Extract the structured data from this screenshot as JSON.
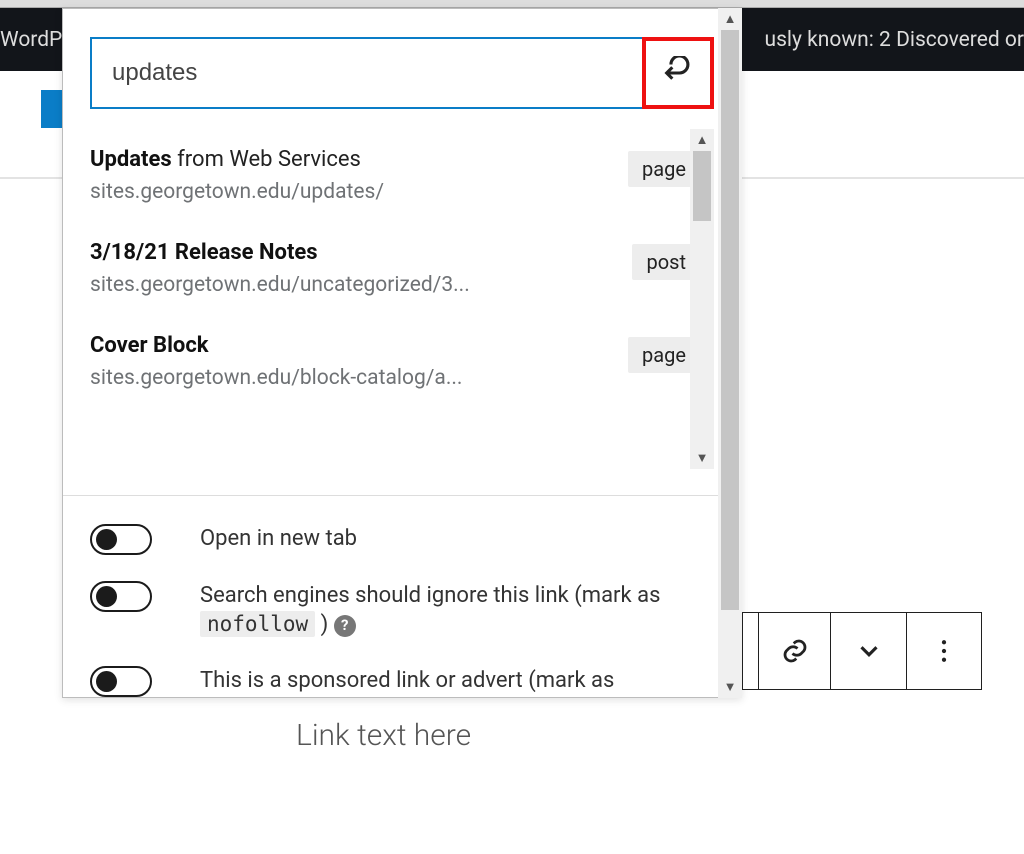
{
  "admin_bar": {
    "left_text": "WordP",
    "right_text": "usly known: 2 Discovered or"
  },
  "popover": {
    "search_value": "updates",
    "results": [
      {
        "title_bold": "Updates",
        "title_rest": " from Web Services",
        "url": "sites.georgetown.edu/updates/",
        "type": "page"
      },
      {
        "title_bold": "",
        "title_rest": "3/18/21 Release Notes",
        "url": "sites.georgetown.edu/uncategorized/3...",
        "type": "post"
      },
      {
        "title_bold": "",
        "title_rest": "Cover Block",
        "url": "sites.georgetown.edu/block-catalog/a...",
        "type": "page"
      }
    ],
    "options": {
      "open_new_tab": "Open in new tab",
      "nofollow_pre": "Search engines should ignore this link (mark as ",
      "nofollow_code": "nofollow",
      "nofollow_post": " ) ",
      "sponsored": "This is a sponsored link or advert (mark as"
    }
  },
  "editor": {
    "placeholder_text": "Link text here"
  }
}
